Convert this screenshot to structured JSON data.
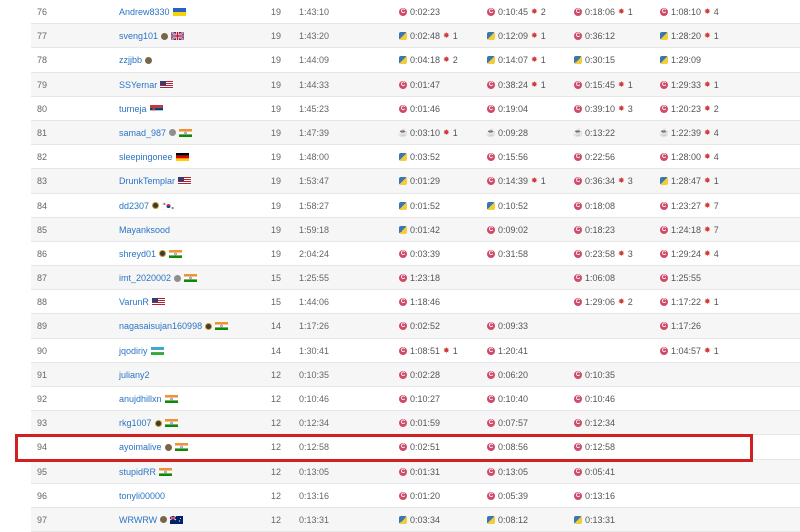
{
  "rows": [
    {
      "rank": "76",
      "name": "Andrew8330",
      "badge": "",
      "flag": "ua",
      "score": "19",
      "time": "1:43:10",
      "p": [
        [
          "cpp",
          "0:02:23",
          ""
        ],
        [
          "cpp",
          "0:10:45",
          "2"
        ],
        [
          "cpp",
          "0:18:06",
          "1"
        ],
        [
          "cpp",
          "1:08:10",
          "4"
        ]
      ]
    },
    {
      "rank": "77",
      "name": "sveng101",
      "badge": "dark",
      "flag": "gb",
      "score": "19",
      "time": "1:43:20",
      "p": [
        [
          "py",
          "0:02:48",
          "1"
        ],
        [
          "py",
          "0:12:09",
          "1"
        ],
        [
          "cpp",
          "0:36:12",
          ""
        ],
        [
          "py",
          "1:28:20",
          "1"
        ]
      ]
    },
    {
      "rank": "78",
      "name": "zzjjbb",
      "badge": "dark",
      "flag": "",
      "score": "19",
      "time": "1:44:09",
      "p": [
        [
          "py",
          "0:04:18",
          "2"
        ],
        [
          "py",
          "0:14:07",
          "1"
        ],
        [
          "py",
          "0:30:15",
          ""
        ],
        [
          "py",
          "1:29:09",
          ""
        ]
      ]
    },
    {
      "rank": "79",
      "name": "SSYernar",
      "badge": "",
      "flag": "us",
      "score": "19",
      "time": "1:44:33",
      "p": [
        [
          "cpp",
          "0:01:47",
          ""
        ],
        [
          "cpp",
          "0:38:24",
          "1"
        ],
        [
          "cpp",
          "0:15:45",
          "1"
        ],
        [
          "cpp",
          "1:29:33",
          "1"
        ]
      ]
    },
    {
      "rank": "80",
      "name": "turneja",
      "badge": "",
      "flag": "rs",
      "score": "19",
      "time": "1:45:23",
      "p": [
        [
          "cpp",
          "0:01:46",
          ""
        ],
        [
          "cpp",
          "0:19:04",
          ""
        ],
        [
          "cpp",
          "0:39:10",
          "3"
        ],
        [
          "cpp",
          "1:20:23",
          "2"
        ]
      ]
    },
    {
      "rank": "81",
      "name": "samad_987",
      "badge": "gray",
      "flag": "in",
      "score": "19",
      "time": "1:47:39",
      "p": [
        [
          "java",
          "0:03:10",
          "1"
        ],
        [
          "java",
          "0:09:28",
          ""
        ],
        [
          "java",
          "0:13:22",
          ""
        ],
        [
          "java",
          "1:22:39",
          "4"
        ]
      ]
    },
    {
      "rank": "82",
      "name": "sleepingonee",
      "badge": "",
      "flag": "de",
      "score": "19",
      "time": "1:48:00",
      "p": [
        [
          "py",
          "0:03:52",
          ""
        ],
        [
          "cpp",
          "0:15:56",
          ""
        ],
        [
          "cpp",
          "0:22:56",
          ""
        ],
        [
          "cpp",
          "1:28:00",
          "4"
        ]
      ]
    },
    {
      "rank": "83",
      "name": "DrunkTemplar",
      "badge": "",
      "flag": "us",
      "score": "19",
      "time": "1:53:47",
      "p": [
        [
          "py",
          "0:01:29",
          ""
        ],
        [
          "cpp",
          "0:14:39",
          "1"
        ],
        [
          "cpp",
          "0:36:34",
          "3"
        ],
        [
          "py",
          "1:28:47",
          "1"
        ]
      ]
    },
    {
      "rank": "84",
      "name": "dd2307",
      "badge": "gold",
      "flag": "kr",
      "score": "19",
      "time": "1:58:27",
      "p": [
        [
          "py",
          "0:01:52",
          ""
        ],
        [
          "py",
          "0:10:52",
          ""
        ],
        [
          "cpp",
          "0:18:08",
          ""
        ],
        [
          "cpp",
          "1:23:27",
          "7"
        ]
      ]
    },
    {
      "rank": "85",
      "name": "Mayanksood",
      "badge": "",
      "flag": "",
      "score": "19",
      "time": "1:59:18",
      "p": [
        [
          "py",
          "0:01:42",
          ""
        ],
        [
          "cpp",
          "0:09:02",
          ""
        ],
        [
          "cpp",
          "0:18:23",
          ""
        ],
        [
          "cpp",
          "1:24:18",
          "7"
        ]
      ]
    },
    {
      "rank": "86",
      "name": "shreyd01",
      "badge": "gold",
      "flag": "in",
      "score": "19",
      "time": "2:04:24",
      "p": [
        [
          "cpp",
          "0:03:39",
          ""
        ],
        [
          "cpp",
          "0:31:58",
          ""
        ],
        [
          "cpp",
          "0:23:58",
          "3"
        ],
        [
          "cpp",
          "1:29:24",
          "4"
        ]
      ]
    },
    {
      "rank": "87",
      "name": "imt_2020002",
      "badge": "gray",
      "flag": "in",
      "score": "15",
      "time": "1:25:55",
      "p": [
        [
          "cpp",
          "1:23:18",
          ""
        ],
        null,
        [
          "cpp",
          "1:06:08",
          ""
        ],
        [
          "cpp",
          "1:25:55",
          ""
        ]
      ]
    },
    {
      "rank": "88",
      "name": "VarunR",
      "badge": "",
      "flag": "us",
      "score": "15",
      "time": "1:44:06",
      "p": [
        [
          "cpp",
          "1:18:46",
          ""
        ],
        null,
        [
          "cpp",
          "1:29:06",
          "2"
        ],
        [
          "cpp",
          "1:17:22",
          "1"
        ]
      ]
    },
    {
      "rank": "89",
      "name": "nagasaisujan160998",
      "badge": "gold",
      "flag": "in",
      "score": "14",
      "time": "1:17:26",
      "p": [
        [
          "cpp",
          "0:02:52",
          ""
        ],
        [
          "cpp",
          "0:09:33",
          ""
        ],
        null,
        [
          "cpp",
          "1:17:26",
          ""
        ]
      ]
    },
    {
      "rank": "90",
      "name": "jqodiriy",
      "badge": "",
      "flag": "uz",
      "score": "14",
      "time": "1:30:41",
      "p": [
        [
          "cpp",
          "1:08:51",
          "1"
        ],
        [
          "cpp",
          "1:20:41",
          ""
        ],
        null,
        [
          "cpp",
          "1:04:57",
          "1"
        ]
      ]
    },
    {
      "rank": "91",
      "name": "juliany2",
      "badge": "",
      "flag": "",
      "score": "12",
      "time": "0:10:35",
      "p": [
        [
          "cpp",
          "0:02:28",
          ""
        ],
        [
          "cpp",
          "0:06:20",
          ""
        ],
        [
          "cpp",
          "0:10:35",
          ""
        ],
        null
      ]
    },
    {
      "rank": "92",
      "name": "anujdhillxn",
      "badge": "",
      "flag": "in",
      "score": "12",
      "time": "0:10:46",
      "p": [
        [
          "cpp",
          "0:10:27",
          ""
        ],
        [
          "cpp",
          "0:10:40",
          ""
        ],
        [
          "cpp",
          "0:10:46",
          ""
        ],
        null
      ]
    },
    {
      "rank": "93",
      "name": "rkg1007",
      "badge": "gold",
      "flag": "in",
      "score": "12",
      "time": "0:12:34",
      "p": [
        [
          "cpp",
          "0:01:59",
          ""
        ],
        [
          "cpp",
          "0:07:57",
          ""
        ],
        [
          "cpp",
          "0:12:34",
          ""
        ],
        null
      ]
    },
    {
      "rank": "94",
      "name": "ayoimalive",
      "badge": "dark",
      "flag": "in",
      "score": "12",
      "time": "0:12:58",
      "p": [
        [
          "cpp",
          "0:02:51",
          ""
        ],
        [
          "cpp",
          "0:08:56",
          ""
        ],
        [
          "cpp",
          "0:12:58",
          ""
        ],
        null
      ]
    },
    {
      "rank": "95",
      "name": "stupidRR",
      "badge": "",
      "flag": "in",
      "score": "12",
      "time": "0:13:05",
      "p": [
        [
          "cpp",
          "0:01:31",
          ""
        ],
        [
          "cpp",
          "0:13:05",
          ""
        ],
        [
          "cpp",
          "0:05:41",
          ""
        ],
        null
      ]
    },
    {
      "rank": "96",
      "name": "tonyli00000",
      "badge": "",
      "flag": "",
      "score": "12",
      "time": "0:13:16",
      "p": [
        [
          "cpp",
          "0:01:20",
          ""
        ],
        [
          "cpp",
          "0:05:39",
          ""
        ],
        [
          "cpp",
          "0:13:16",
          ""
        ],
        null
      ]
    },
    {
      "rank": "97",
      "name": "WRWRW",
      "badge": "dark",
      "flag": "au",
      "score": "12",
      "time": "0:13:31",
      "p": [
        [
          "py",
          "0:03:34",
          ""
        ],
        [
          "py",
          "0:08:12",
          ""
        ],
        [
          "py",
          "0:13:31",
          ""
        ],
        null
      ]
    }
  ],
  "highlighted_rank": "94"
}
